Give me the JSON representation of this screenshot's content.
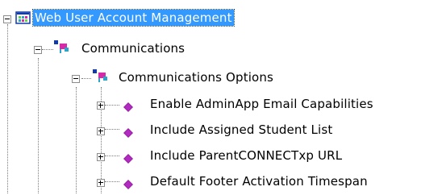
{
  "tree": {
    "root": {
      "label": "Web User Account Management",
      "expanded": true,
      "selected": true,
      "icon": "form-window-icon"
    },
    "level1": {
      "label": "Communications",
      "expanded": true,
      "icon": "category-node-icon"
    },
    "level2": {
      "label": "Communications Options",
      "expanded": true,
      "icon": "category-node-icon"
    },
    "options": [
      {
        "label": "Enable AdminApp Email Capabilities",
        "icon": "purple-diamond-icon",
        "expanded": false
      },
      {
        "label": "Include Assigned Student List",
        "icon": "purple-diamond-icon",
        "expanded": false
      },
      {
        "label": "Include ParentCONNECTxp URL",
        "icon": "purple-diamond-icon",
        "expanded": false
      },
      {
        "label": "Default Footer Activation Timespan",
        "icon": "purple-diamond-icon",
        "expanded": false
      }
    ],
    "colors": {
      "selection_bg": "#3399ff",
      "selection_text": "#ffffff",
      "diamond": "#9b1fa6",
      "node_blue": "#123aa9",
      "node_pink": "#d62aa9",
      "node_teal": "#2ba6c8"
    }
  }
}
